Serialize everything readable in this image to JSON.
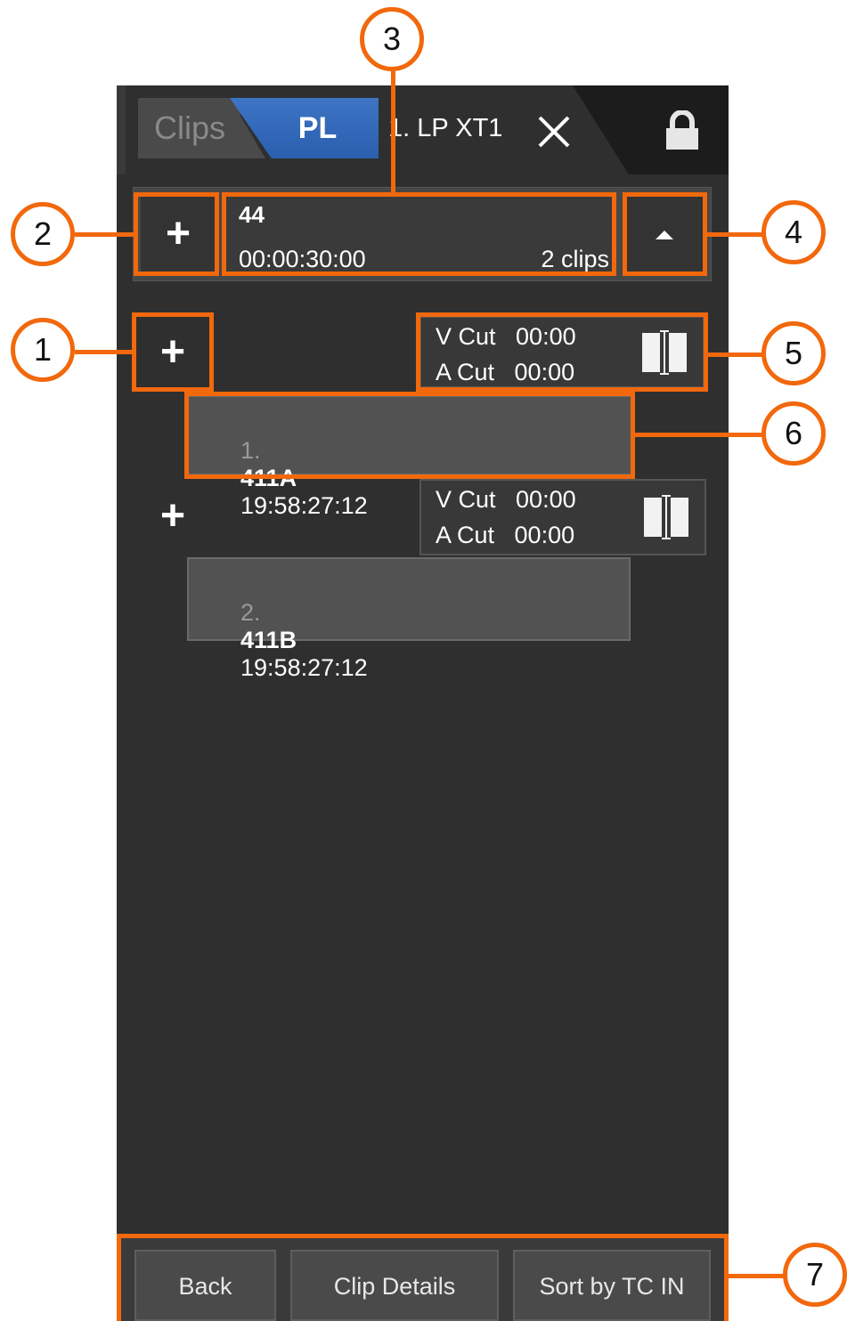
{
  "tabs": {
    "clips_label": "Clips",
    "pl_label": "PL",
    "playlist_name": "1. LP XT1"
  },
  "playlist": {
    "name": "44",
    "duration": "00:00:30:00",
    "clip_count": "2 clips"
  },
  "transitions": [
    {
      "v_cut": "V Cut   00:00",
      "a_cut": "A Cut   00:00"
    },
    {
      "v_cut": "V Cut   00:00",
      "a_cut": "A Cut   00:00"
    }
  ],
  "clips": [
    {
      "index": "1.",
      "name": "411A",
      "timecode": "19:58:27:12"
    },
    {
      "index": "2.",
      "name": "411B",
      "timecode": "19:58:27:12"
    }
  ],
  "footer": {
    "back": "Back",
    "clip_details": "Clip Details",
    "sort": "Sort by TC IN"
  },
  "callouts": [
    "1",
    "2",
    "3",
    "4",
    "5",
    "6",
    "7"
  ],
  "colors": {
    "accent": "#f2680c",
    "tab_active": "#2a5fae",
    "background": "#2f2f2f"
  }
}
